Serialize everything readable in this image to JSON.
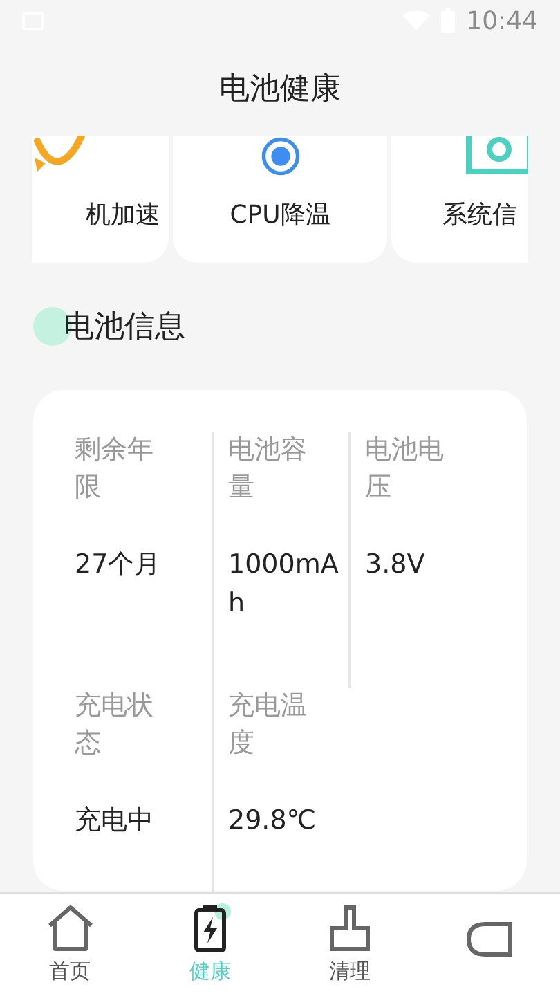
{
  "status_bar": {
    "time": "10:44"
  },
  "header": {
    "title": "电池健康"
  },
  "shortcuts": [
    {
      "kind": "boost",
      "label": "机加速"
    },
    {
      "kind": "cpu",
      "label": "CPU降温"
    },
    {
      "kind": "system",
      "label": "系统信"
    }
  ],
  "section": {
    "title": "电池信息"
  },
  "battery_info": [
    {
      "label": "剩余年限",
      "value": "27个月"
    },
    {
      "label": "电池容量",
      "value": "1000mAh"
    },
    {
      "label": "电池电压",
      "value": "3.8V"
    },
    {
      "label": "充电状态",
      "value": "充电中"
    },
    {
      "label": "充电温度",
      "value": "29.8℃"
    }
  ],
  "tab_bar": [
    {
      "kind": "home",
      "label": "首页",
      "selected": false
    },
    {
      "kind": "battery",
      "label": "健康",
      "selected": true
    },
    {
      "kind": "clean",
      "label": "清理",
      "selected": false
    },
    {
      "kind": "profile",
      "selected": false
    }
  ]
}
